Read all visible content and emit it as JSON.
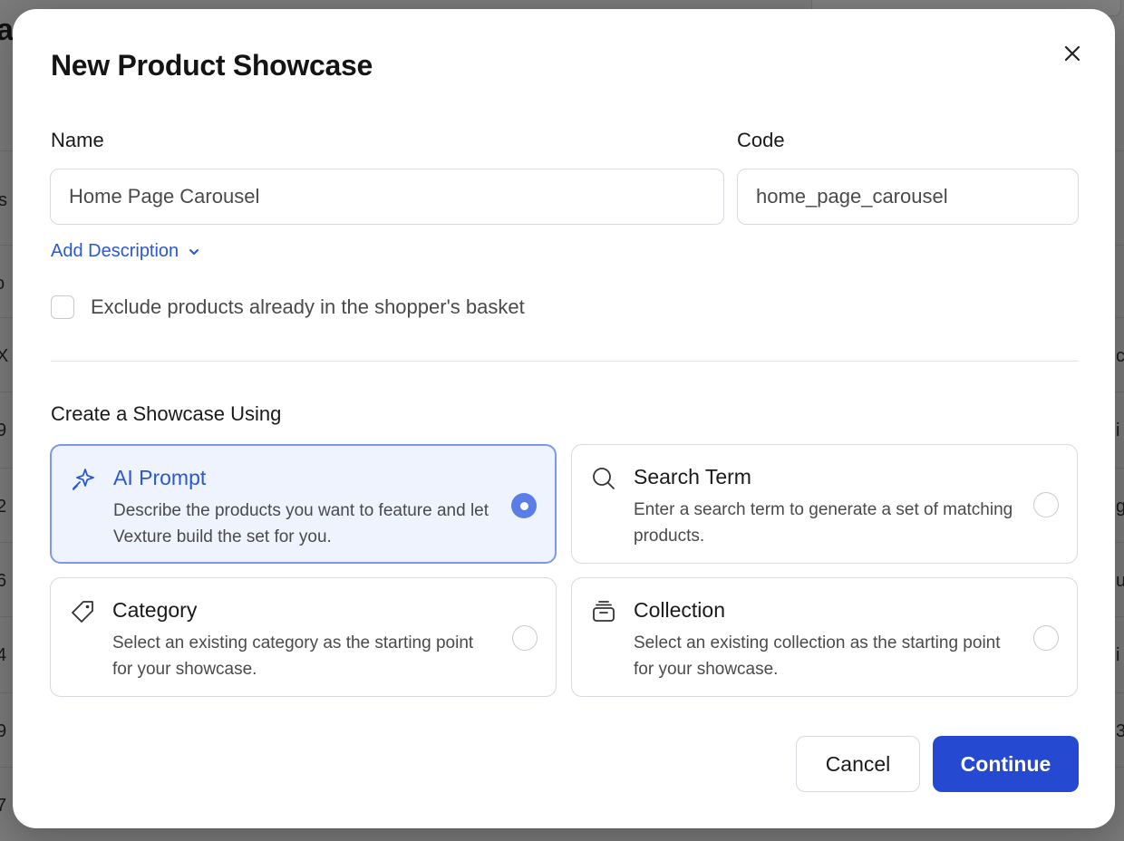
{
  "dialog": {
    "title": "New Product Showcase",
    "name_label": "Name",
    "name_value": "Home Page Carousel",
    "code_label": "Code",
    "code_value": "home_page_carousel",
    "add_description_label": "Add Description",
    "exclude_label": "Exclude products already in the shopper's basket",
    "exclude_checked": false,
    "section_label": "Create a Showcase Using",
    "options": [
      {
        "icon": "sparkle-icon",
        "title": "AI Prompt",
        "description": "Describe the products you want to feature and let Vexture build the set for you.",
        "selected": true
      },
      {
        "icon": "search-icon",
        "title": "Search Term",
        "description": "Enter a search term to generate a set of matching products.",
        "selected": false
      },
      {
        "icon": "tag-icon",
        "title": "Category",
        "description": "Select an existing category as the starting point for your showcase.",
        "selected": false
      },
      {
        "icon": "collection-icon",
        "title": "Collection",
        "description": "Select an existing collection as the starting point for your showcase.",
        "selected": false
      }
    ],
    "cancel_label": "Cancel",
    "continue_label": "Continue"
  },
  "background": {
    "title_fragment": "a",
    "row_fragments": [
      "s",
      "o",
      "X",
      "9",
      "2",
      "6",
      "4",
      "9",
      "7"
    ],
    "right_fragments": [
      "c",
      "i",
      "g",
      "u",
      "i",
      "3"
    ]
  },
  "colors": {
    "accent": "#2549d1",
    "link": "#2a58d4",
    "selected_bg": "#eff3fd",
    "selected_border": "#7b98ee",
    "radio_selected": "#5a7de8"
  }
}
